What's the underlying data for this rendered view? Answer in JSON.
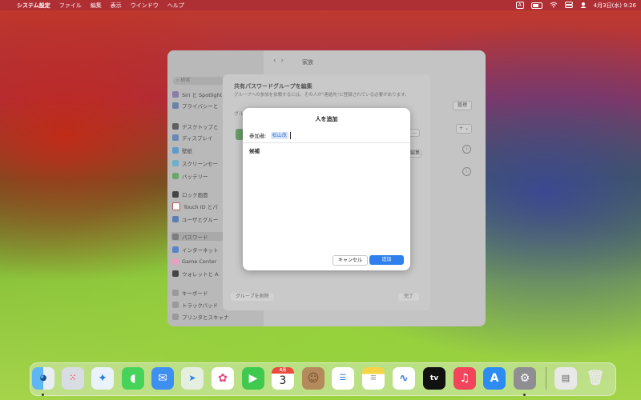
{
  "menubar": {
    "apple": "",
    "items": [
      "システム設定",
      "ファイル",
      "編集",
      "表示",
      "ウインドウ",
      "ヘルプ"
    ],
    "input_indicator": "A",
    "clock": "4月3日(水) 9:26"
  },
  "settings_window": {
    "search_placeholder": "検索",
    "page_title": "家族",
    "sidebar_items": [
      "Siri と Spotlight",
      "プライバシーと",
      "デスクトップと",
      "ディスプレイ",
      "壁紙",
      "スクリーンセー",
      "バッテリー",
      "ロック画面",
      "Touch ID とパ",
      "ユーザとグルー",
      "パスワード",
      "インターネット",
      "Game Center",
      "ウォレットと A",
      "キーボード",
      "トラックパッド",
      "プリンタとスキャナ"
    ],
    "manage_button": "管理",
    "edit_button": "編集",
    "group_label": "グル"
  },
  "sheet": {
    "title": "共有パスワードグループを編集",
    "subtitle": "グループへの参加を依頼するには、その人が\"連絡先\"に登録されている必要があります。",
    "delete_group": "グループを削除",
    "done": "完了",
    "add_stepper": "+ ⌄"
  },
  "dialog": {
    "title": "人を追加",
    "participant_label": "参加者:",
    "participant_value": "松山茂",
    "candidates_label": "候補",
    "cancel": "キャンセル",
    "add": "追加"
  },
  "dock": {
    "calendar_month": "4月",
    "calendar_day": "3"
  },
  "colors": {
    "accent": "#2f80ed",
    "token_bg": "#dce8fb"
  }
}
